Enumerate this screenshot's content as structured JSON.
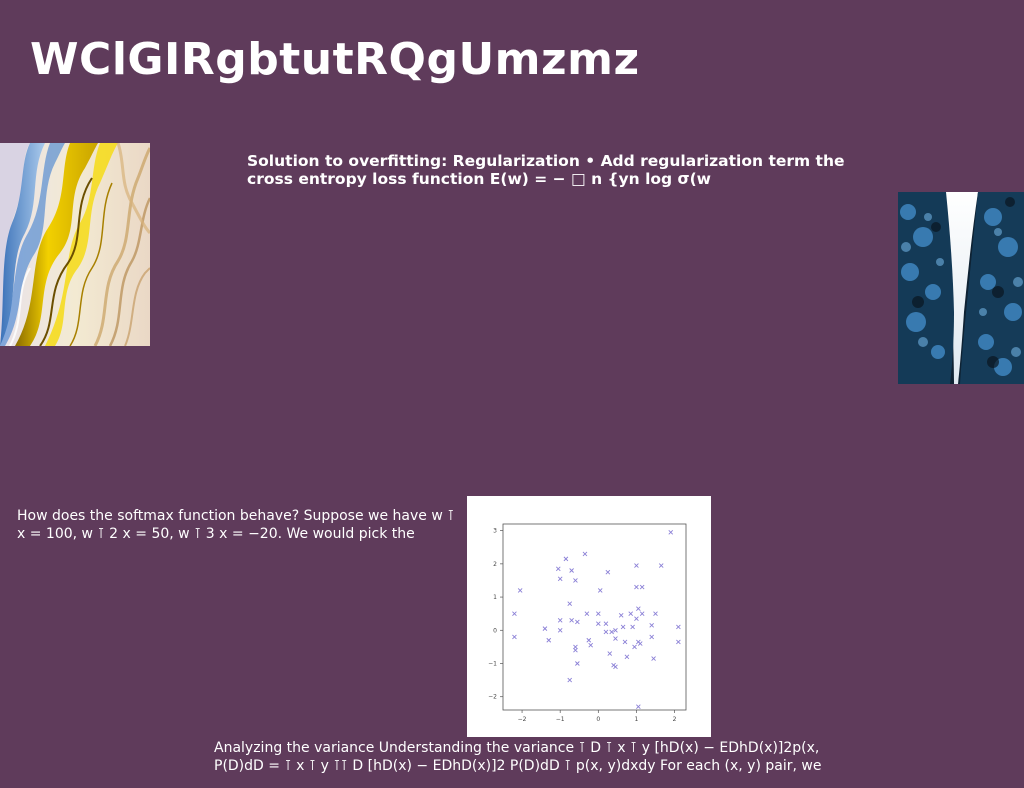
{
  "slide": {
    "title": "WClGIRgbtutRQgUmzmz",
    "regularization_text": "Solution to overfitting: Regularization • Add regularization term the cross entropy loss function E(w) = − □ n {yn log σ(w",
    "softmax_text": "How does the softmax function behave? Suppose we have w ⊺ x = 100, w ⊺ 2 x = 50, w ⊺ 3 x = −20. We would pick the",
    "variance_text": "Analyzing the variance Understanding the variance ⊺ D ⊺ x ⊺ y [hD(x) − EDhD(x)]2p(x, P(D)dD = ⊺ x ⊺ y ⊺⊺ D [hD(x) − EDhD(x)]2 P(D)dD ⊺ p(x, y)dxdy For each (x, y) pair, we"
  },
  "chart_data": {
    "type": "scatter",
    "title": "",
    "xlabel": "",
    "ylabel": "",
    "xlim": [
      -2.5,
      2.3
    ],
    "ylim": [
      -2.4,
      3.2
    ],
    "xticks": [
      -2,
      -1,
      0,
      1,
      2
    ],
    "yticks": [
      -2,
      -1,
      0,
      1,
      2,
      3
    ],
    "marker": "x",
    "color": "#8a7fd6",
    "points": [
      [
        -2.2,
        -0.2
      ],
      [
        -2.2,
        0.5
      ],
      [
        -2.05,
        1.2
      ],
      [
        -1.4,
        0.05
      ],
      [
        -1.3,
        -0.3
      ],
      [
        -1.05,
        1.85
      ],
      [
        -1.0,
        1.55
      ],
      [
        -1.0,
        0.3
      ],
      [
        -1.0,
        0.0
      ],
      [
        -0.85,
        2.15
      ],
      [
        -0.75,
        -1.5
      ],
      [
        -0.75,
        0.8
      ],
      [
        -0.7,
        1.8
      ],
      [
        -0.7,
        0.3
      ],
      [
        -0.6,
        1.5
      ],
      [
        -0.6,
        -0.5
      ],
      [
        -0.6,
        -0.6
      ],
      [
        -0.55,
        0.25
      ],
      [
        -0.55,
        -1.0
      ],
      [
        -0.35,
        2.3
      ],
      [
        -0.3,
        0.5
      ],
      [
        -0.25,
        -0.3
      ],
      [
        -0.2,
        -0.45
      ],
      [
        0.0,
        0.5
      ],
      [
        0.0,
        0.2
      ],
      [
        0.05,
        1.2
      ],
      [
        0.2,
        -0.05
      ],
      [
        0.2,
        0.2
      ],
      [
        0.25,
        1.75
      ],
      [
        0.3,
        -0.7
      ],
      [
        0.35,
        -0.05
      ],
      [
        0.4,
        -1.05
      ],
      [
        0.45,
        -1.1
      ],
      [
        0.45,
        0.0
      ],
      [
        0.45,
        -0.25
      ],
      [
        0.6,
        0.45
      ],
      [
        0.65,
        0.1
      ],
      [
        0.7,
        -0.35
      ],
      [
        0.75,
        -0.8
      ],
      [
        0.85,
        0.5
      ],
      [
        0.9,
        0.1
      ],
      [
        0.95,
        -0.5
      ],
      [
        1.0,
        1.95
      ],
      [
        1.0,
        1.3
      ],
      [
        1.0,
        0.35
      ],
      [
        1.05,
        0.65
      ],
      [
        1.05,
        -0.35
      ],
      [
        1.05,
        -2.3
      ],
      [
        1.1,
        -0.4
      ],
      [
        1.15,
        1.3
      ],
      [
        1.15,
        0.5
      ],
      [
        1.4,
        0.15
      ],
      [
        1.4,
        -0.2
      ],
      [
        1.45,
        -0.85
      ],
      [
        1.5,
        0.5
      ],
      [
        1.65,
        1.95
      ],
      [
        1.9,
        2.95
      ],
      [
        2.1,
        0.1
      ],
      [
        2.1,
        -0.35
      ]
    ]
  }
}
